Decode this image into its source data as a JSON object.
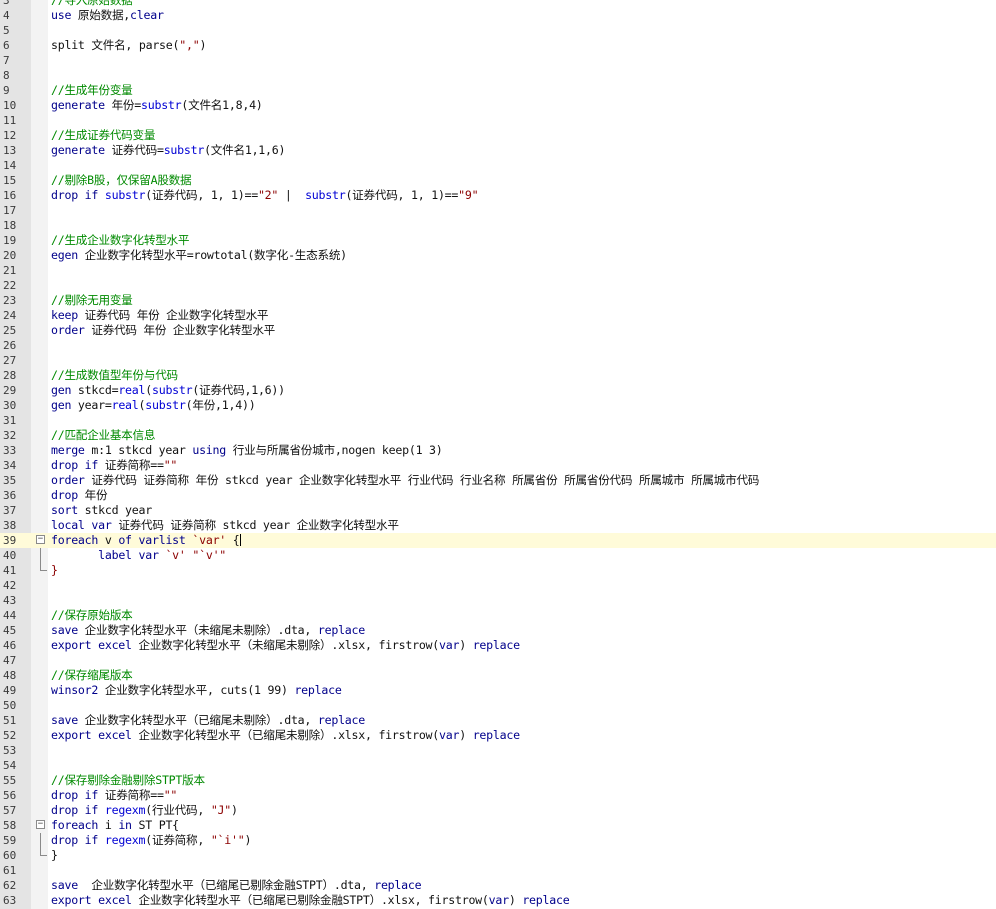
{
  "editor": {
    "current_line": 38,
    "lines": [
      {
        "n": "3",
        "t": [
          [
            "cm",
            "//导入原始数据"
          ]
        ]
      },
      {
        "n": "4",
        "t": [
          [
            "kw",
            "use"
          ],
          [
            "pl",
            " 原始数据,"
          ],
          [
            "kw",
            "clear"
          ]
        ]
      },
      {
        "n": "5",
        "t": []
      },
      {
        "n": "6",
        "t": [
          [
            "pl",
            "split 文件名, parse("
          ],
          [
            "st",
            "\",\""
          ],
          [
            "pl",
            ")"
          ]
        ]
      },
      {
        "n": "7",
        "t": []
      },
      {
        "n": "8",
        "t": []
      },
      {
        "n": "9",
        "t": [
          [
            "cm",
            "//生成年份变量"
          ]
        ]
      },
      {
        "n": "10",
        "t": [
          [
            "kw",
            "generate"
          ],
          [
            "pl",
            " 年份="
          ],
          [
            "fn",
            "substr"
          ],
          [
            "pl",
            "(文件名1,8,4)"
          ]
        ]
      },
      {
        "n": "11",
        "t": []
      },
      {
        "n": "12",
        "t": [
          [
            "cm",
            "//生成证券代码变量"
          ]
        ]
      },
      {
        "n": "13",
        "t": [
          [
            "kw",
            "generate"
          ],
          [
            "pl",
            " 证券代码="
          ],
          [
            "fn",
            "substr"
          ],
          [
            "pl",
            "(文件名1,1,6)"
          ]
        ]
      },
      {
        "n": "14",
        "t": []
      },
      {
        "n": "15",
        "t": [
          [
            "cm",
            "//剔除B股，仅保留A股数据"
          ]
        ]
      },
      {
        "n": "16",
        "t": [
          [
            "kw",
            "drop if"
          ],
          [
            "pl",
            " "
          ],
          [
            "fn",
            "substr"
          ],
          [
            "pl",
            "(证券代码, 1, 1)=="
          ],
          [
            "st",
            "\"2\""
          ],
          [
            "pl",
            " |  "
          ],
          [
            "fn",
            "substr"
          ],
          [
            "pl",
            "(证券代码, 1, 1)=="
          ],
          [
            "st",
            "\"9\""
          ]
        ]
      },
      {
        "n": "17",
        "t": []
      },
      {
        "n": "18",
        "t": []
      },
      {
        "n": "19",
        "t": [
          [
            "cm",
            "//生成企业数字化转型水平"
          ]
        ]
      },
      {
        "n": "20",
        "t": [
          [
            "kw",
            "egen"
          ],
          [
            "pl",
            " 企业数字化转型水平=rowtotal(数字化-生态系统)"
          ]
        ]
      },
      {
        "n": "21",
        "t": []
      },
      {
        "n": "22",
        "t": []
      },
      {
        "n": "23",
        "t": [
          [
            "cm",
            "//剔除无用变量"
          ]
        ]
      },
      {
        "n": "24",
        "t": [
          [
            "kw",
            "keep"
          ],
          [
            "pl",
            " 证券代码 年份 企业数字化转型水平"
          ]
        ]
      },
      {
        "n": "25",
        "t": [
          [
            "kw",
            "order"
          ],
          [
            "pl",
            " 证券代码 年份 企业数字化转型水平"
          ]
        ]
      },
      {
        "n": "26",
        "t": []
      },
      {
        "n": "27",
        "t": []
      },
      {
        "n": "28",
        "t": [
          [
            "cm",
            "//生成数值型年份与代码"
          ]
        ]
      },
      {
        "n": "29",
        "t": [
          [
            "kw",
            "gen"
          ],
          [
            "pl",
            " stkcd="
          ],
          [
            "fn",
            "real"
          ],
          [
            "pl",
            "("
          ],
          [
            "fn",
            "substr"
          ],
          [
            "pl",
            "(证券代码,1,6))"
          ]
        ]
      },
      {
        "n": "30",
        "t": [
          [
            "kw",
            "gen"
          ],
          [
            "pl",
            " year="
          ],
          [
            "fn",
            "real"
          ],
          [
            "pl",
            "("
          ],
          [
            "fn",
            "substr"
          ],
          [
            "pl",
            "(年份,1,4))"
          ]
        ]
      },
      {
        "n": "31",
        "t": []
      },
      {
        "n": "32",
        "t": [
          [
            "cm",
            "//匹配企业基本信息"
          ]
        ]
      },
      {
        "n": "33",
        "t": [
          [
            "kw",
            "merge"
          ],
          [
            "pl",
            " m:1 stkcd year "
          ],
          [
            "kw",
            "using"
          ],
          [
            "pl",
            " 行业与所属省份城市,nogen keep(1 3)"
          ]
        ]
      },
      {
        "n": "34",
        "t": [
          [
            "kw",
            "drop if"
          ],
          [
            "pl",
            " 证券简称=="
          ],
          [
            "st",
            "\"\""
          ]
        ]
      },
      {
        "n": "35",
        "t": [
          [
            "kw",
            "order"
          ],
          [
            "pl",
            " 证券代码 证券简称 年份 stkcd year 企业数字化转型水平 行业代码 行业名称 所属省份 所属省份代码 所属城市 所属城市代码"
          ]
        ]
      },
      {
        "n": "36",
        "t": [
          [
            "kw",
            "drop"
          ],
          [
            "pl",
            " 年份"
          ]
        ]
      },
      {
        "n": "37",
        "t": [
          [
            "kw",
            "sort"
          ],
          [
            "pl",
            " stkcd year"
          ]
        ]
      },
      {
        "n": "38",
        "t": [
          [
            "kw",
            "local"
          ],
          [
            "pl",
            " "
          ],
          [
            "kw",
            "var"
          ],
          [
            "pl",
            " 证券代码 证券简称 stkcd year 企业数字化转型水平"
          ]
        ]
      },
      {
        "n": "39",
        "fold": "box",
        "t": [
          [
            "kw",
            "foreach"
          ],
          [
            "pl",
            " v "
          ],
          [
            "kw",
            "of varlist"
          ],
          [
            "pl",
            " "
          ],
          [
            "st",
            "`var'"
          ],
          [
            "pl",
            " {"
          ]
        ],
        "caret": true
      },
      {
        "n": "40",
        "fold": "line",
        "t": [
          [
            "pl",
            "       "
          ],
          [
            "kw",
            "label var"
          ],
          [
            "pl",
            " "
          ],
          [
            "st",
            "`v'"
          ],
          [
            "pl",
            " "
          ],
          [
            "st",
            "\"`v'\""
          ]
        ]
      },
      {
        "n": "41",
        "fold": "end",
        "t": [
          [
            "st",
            "}"
          ]
        ]
      },
      {
        "n": "42",
        "t": []
      },
      {
        "n": "43",
        "t": []
      },
      {
        "n": "44",
        "t": [
          [
            "cm",
            "//保存原始版本"
          ]
        ]
      },
      {
        "n": "45",
        "t": [
          [
            "kw",
            "save"
          ],
          [
            "pl",
            " 企业数字化转型水平（未缩尾未剔除）.dta, "
          ],
          [
            "kw",
            "replace"
          ]
        ]
      },
      {
        "n": "46",
        "t": [
          [
            "kw",
            "export excel"
          ],
          [
            "pl",
            " 企业数字化转型水平（未缩尾未剔除）.xlsx, firstrow("
          ],
          [
            "kw",
            "var"
          ],
          [
            "pl",
            ") "
          ],
          [
            "kw",
            "replace"
          ]
        ]
      },
      {
        "n": "47",
        "t": []
      },
      {
        "n": "48",
        "t": [
          [
            "cm",
            "//保存缩尾版本"
          ]
        ]
      },
      {
        "n": "49",
        "t": [
          [
            "kw",
            "winsor2"
          ],
          [
            "pl",
            " 企业数字化转型水平, cuts(1 99) "
          ],
          [
            "kw",
            "replace"
          ]
        ]
      },
      {
        "n": "50",
        "t": []
      },
      {
        "n": "51",
        "t": [
          [
            "kw",
            "save"
          ],
          [
            "pl",
            " 企业数字化转型水平（已缩尾未剔除）.dta, "
          ],
          [
            "kw",
            "replace"
          ]
        ]
      },
      {
        "n": "52",
        "t": [
          [
            "kw",
            "export excel"
          ],
          [
            "pl",
            " 企业数字化转型水平（已缩尾未剔除）.xlsx, firstrow("
          ],
          [
            "kw",
            "var"
          ],
          [
            "pl",
            ") "
          ],
          [
            "kw",
            "replace"
          ]
        ]
      },
      {
        "n": "53",
        "t": []
      },
      {
        "n": "54",
        "t": []
      },
      {
        "n": "55",
        "t": [
          [
            "cm",
            "//保存剔除金融剔除STPT版本"
          ]
        ]
      },
      {
        "n": "56",
        "t": [
          [
            "kw",
            "drop if"
          ],
          [
            "pl",
            " 证券简称=="
          ],
          [
            "st",
            "\"\""
          ]
        ]
      },
      {
        "n": "57",
        "t": [
          [
            "kw",
            "drop if"
          ],
          [
            "pl",
            " "
          ],
          [
            "fn",
            "regexm"
          ],
          [
            "pl",
            "(行业代码, "
          ],
          [
            "st",
            "\"J\""
          ],
          [
            "pl",
            ")"
          ]
        ]
      },
      {
        "n": "58",
        "fold": "box",
        "t": [
          [
            "kw",
            "foreach"
          ],
          [
            "pl",
            " i "
          ],
          [
            "kw",
            "in"
          ],
          [
            "pl",
            " ST PT{"
          ]
        ]
      },
      {
        "n": "59",
        "fold": "line",
        "t": [
          [
            "kw",
            "drop if"
          ],
          [
            "pl",
            " "
          ],
          [
            "fn",
            "regexm"
          ],
          [
            "pl",
            "(证券简称, "
          ],
          [
            "st",
            "\"`i'\""
          ],
          [
            "pl",
            ")"
          ]
        ]
      },
      {
        "n": "60",
        "fold": "end",
        "t": [
          [
            "pl",
            "}"
          ]
        ]
      },
      {
        "n": "61",
        "t": []
      },
      {
        "n": "62",
        "t": [
          [
            "kw",
            "save"
          ],
          [
            "pl",
            "  企业数字化转型水平（已缩尾已剔除金融STPT）.dta, "
          ],
          [
            "kw",
            "replace"
          ]
        ]
      },
      {
        "n": "63",
        "t": [
          [
            "kw",
            "export excel"
          ],
          [
            "pl",
            " 企业数字化转型水平（已缩尾已剔除金融STPT）.xlsx, firstrow("
          ],
          [
            "kw",
            "var"
          ],
          [
            "pl",
            ") "
          ],
          [
            "kw",
            "replace"
          ]
        ]
      }
    ]
  }
}
